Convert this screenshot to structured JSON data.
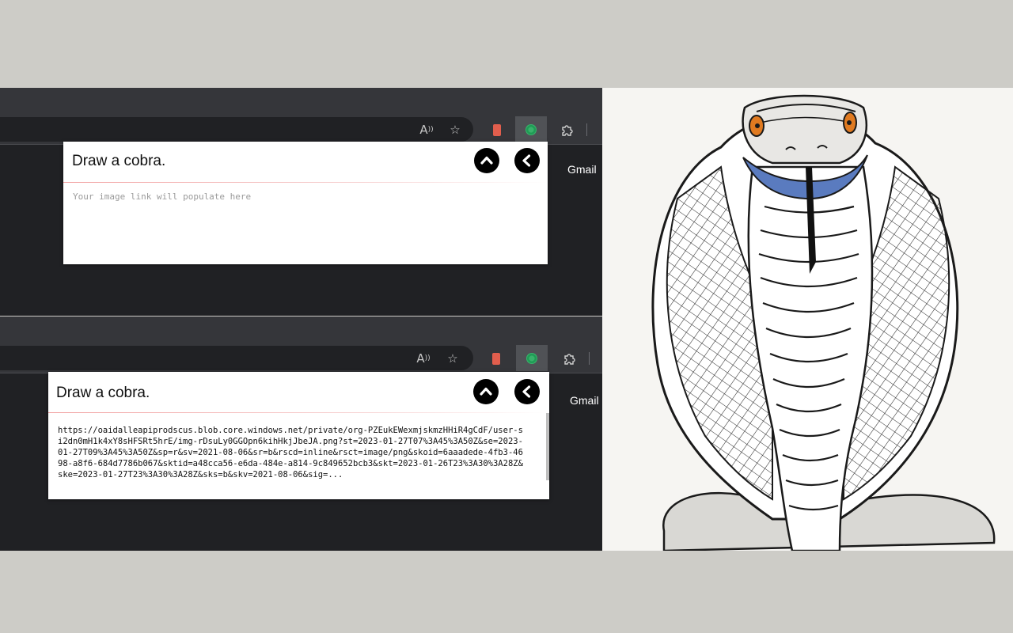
{
  "browser_top": {
    "toolbar": {
      "read_aloud_icon": "read-aloud-icon",
      "favorites_icon": "add-favorite-icon",
      "extensions_icon": "puzzle-icon"
    },
    "bookmark_link": "Gmail",
    "popup": {
      "prompt": "Draw a cobra.",
      "placeholder": "Your image link will populate here",
      "collapse_icon": "chevron-up-icon",
      "back_icon": "chevron-left-icon"
    }
  },
  "browser_bottom": {
    "bookmark_link": "Gmail",
    "popup": {
      "prompt": "Draw a cobra.",
      "image_link": "https://oaidalleapiprodscus.blob.core.windows.net/private/org-PZEukEWexmjskmzHHiR4gCdF/user-si2dn0mH1k4xY8sHFSRt5hrE/img-rDsuLy0GGOpn6kihHkjJbeJA.png?st=2023-01-27T07%3A45%3A50Z&se=2023-01-27T09%3A45%3A50Z&sp=r&sv=2021-08-06&sr=b&rscd=inline&rsct=image/png&skoid=6aaadede-4fb3-4698-a8f6-684d7786b067&sktid=a48cca56-e6da-484e-a814-9c849652bcb3&skt=2023-01-26T23%3A30%3A28Z&ske=2023-01-27T23%3A30%3A28Z&sks=b&skv=2021-08-06&sig=...",
      "collapse_icon": "chevron-up-icon",
      "back_icon": "chevron-left-icon"
    }
  },
  "generated_image": {
    "subject": "cobra-illustration"
  },
  "colors": {
    "browser_bg": "#202124",
    "toolbar_bg": "#35363a",
    "accent_rule": "#f2a3a3",
    "ext_red": "#e15e4d",
    "ext_green": "#1f9b55",
    "cobra_eye": "#e07a20",
    "cobra_throat": "#5a7bbf"
  }
}
